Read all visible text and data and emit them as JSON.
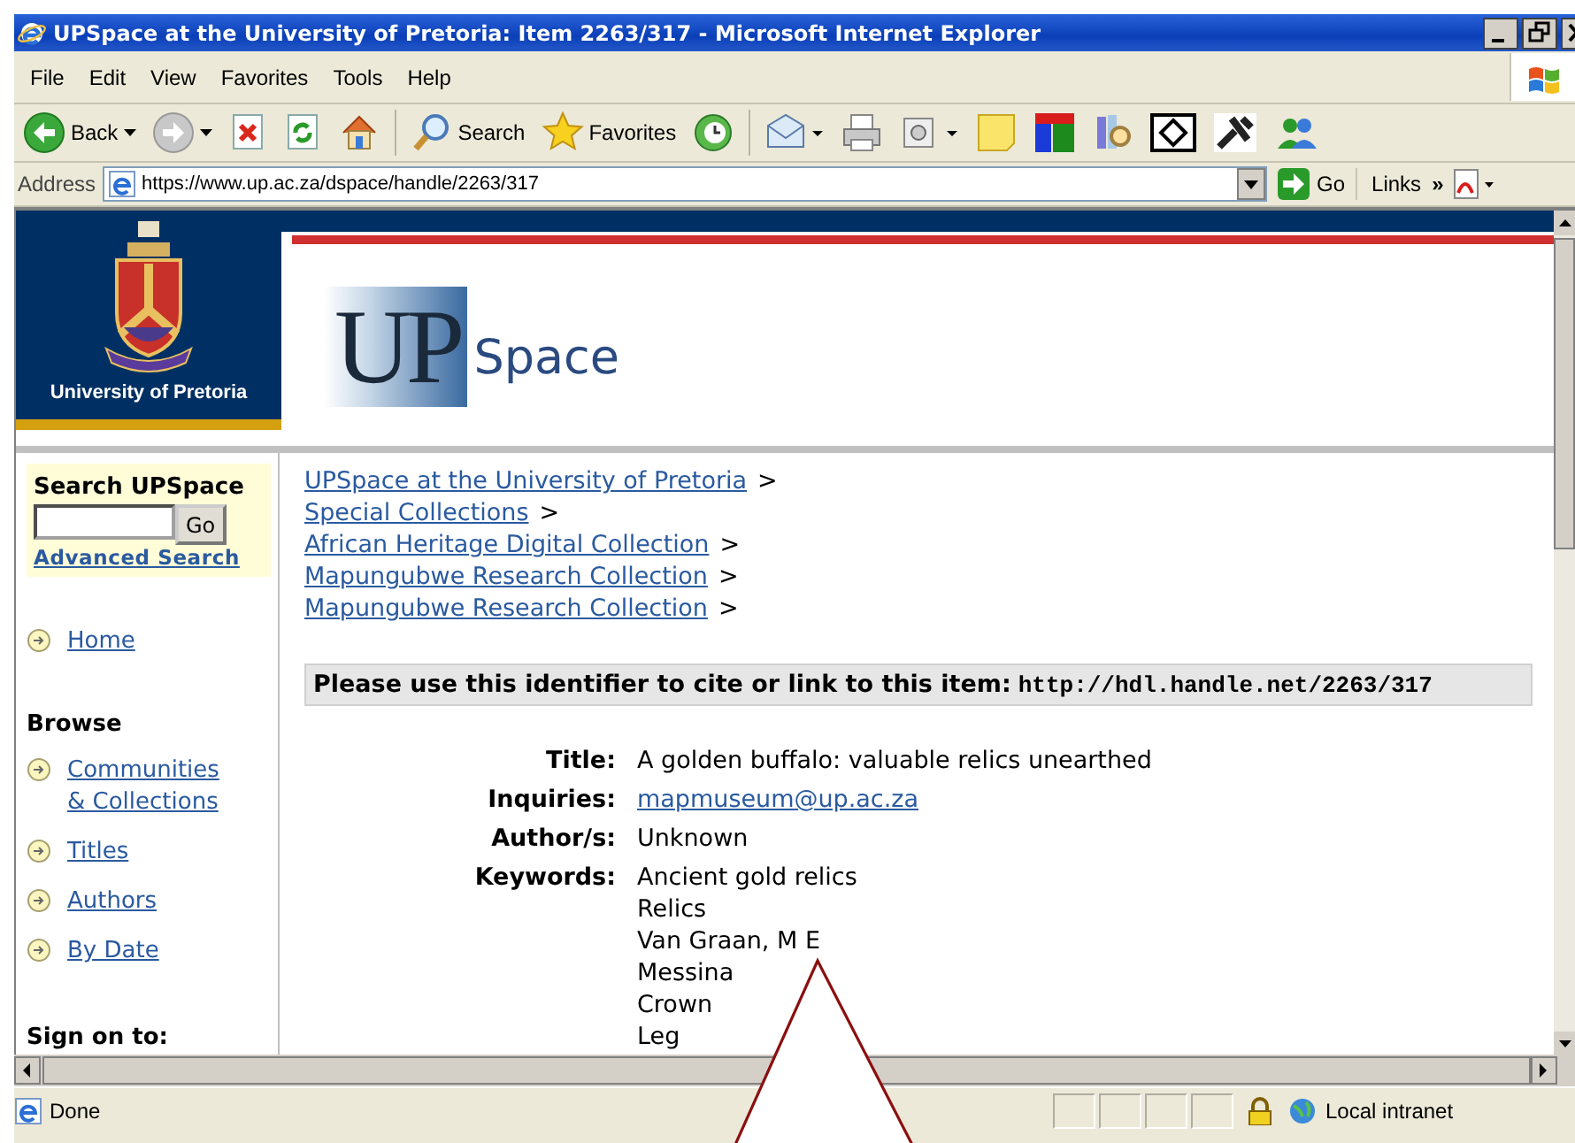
{
  "window": {
    "title": "UPSpace at the University of Pretoria: Item 2263/317 - Microsoft Internet Explorer"
  },
  "menu": [
    "File",
    "Edit",
    "View",
    "Favorites",
    "Tools",
    "Help"
  ],
  "toolbar": [
    {
      "kind": "back",
      "label": "Back"
    },
    {
      "kind": "forward"
    },
    {
      "kind": "stop"
    },
    {
      "kind": "refresh"
    },
    {
      "kind": "home"
    },
    {
      "kind": "search",
      "label": "Search"
    },
    {
      "kind": "favorites",
      "label": "Favorites"
    },
    {
      "kind": "history"
    },
    {
      "kind": "mail"
    },
    {
      "kind": "print"
    },
    {
      "kind": "edit"
    },
    {
      "kind": "note"
    },
    {
      "kind": "blocks"
    },
    {
      "kind": "research"
    },
    {
      "kind": "diamond"
    },
    {
      "kind": "tools"
    },
    {
      "kind": "messenger"
    }
  ],
  "address": {
    "label": "Address",
    "value": "https://www.up.ac.za/dspace/handle/2263/317",
    "go": "Go",
    "links": "Links",
    "more": "»"
  },
  "header": {
    "university": "University of Pretoria",
    "logo_main": "UP",
    "logo_sub": "Space"
  },
  "sidebar": {
    "search_title": "Search UPSpace",
    "go": "Go",
    "advanced": "Advanced Search",
    "home": "Home",
    "browse_title": "Browse",
    "browse": [
      "Communities & Collections",
      "Titles",
      "Authors",
      "By Date"
    ],
    "sign_on": "Sign on to:"
  },
  "breadcrumbs": [
    {
      "label": "UPSpace at the University of Pretoria",
      "sep": ">"
    },
    {
      "label": "Special Collections",
      "sep": ">"
    },
    {
      "label": "African Heritage Digital Collection",
      "sep": ">"
    },
    {
      "label": "Mapungubwe Research Collection",
      "sep": ">"
    },
    {
      "label": "Mapungubwe Research Collection",
      "sep": ">"
    }
  ],
  "identifier": {
    "text": "Please use this identifier to cite or link to this item:",
    "url": "http://hdl.handle.net/2263/317"
  },
  "metadata": [
    {
      "label": "Title:",
      "kind": "text",
      "values": [
        "A golden buffalo: valuable relics unearthed"
      ]
    },
    {
      "label": "Inquiries:",
      "kind": "link",
      "values": [
        "mapmuseum@up.ac.za"
      ]
    },
    {
      "label": "Author/s:",
      "kind": "text",
      "values": [
        "Unknown"
      ]
    },
    {
      "label": "Keywords:",
      "kind": "text",
      "values": [
        "Ancient gold relics",
        "Relics",
        "Van Graan, M E",
        "Messina",
        "Crown",
        "Leg"
      ]
    }
  ],
  "status_bar": {
    "text": "Done",
    "zone": "Local intranet"
  }
}
